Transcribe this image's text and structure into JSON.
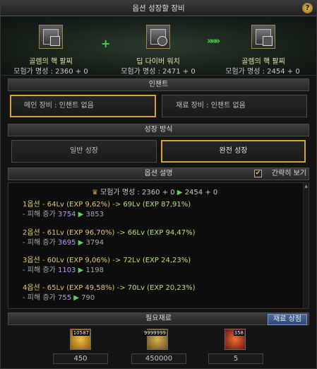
{
  "title": "옵션 성장할 장비",
  "help_label": "?",
  "items": {
    "left": {
      "name": "골렘의 핵 팔찌",
      "fame": "모험가 명성 : 2360 + 0"
    },
    "middle": {
      "name": "딥 다이버 워치",
      "fame": "모험가 명성 : 2471 + 0"
    },
    "right": {
      "name": "골렘의 핵 팔찌",
      "fame": "모험가 명성 : 2454 + 0"
    },
    "plus": "+",
    "arrows": "»»»"
  },
  "enchant": {
    "header": "인챈트",
    "main": "메인 장비 : 인챈트 없음",
    "material": "재료 장비 : 인챈트 없음"
  },
  "growth": {
    "header": "성장 방식",
    "normal": "일반 성장",
    "full": "완전 성장",
    "selected": "full"
  },
  "options": {
    "header": "옵션 설명",
    "simple_label": "간략히 보기",
    "simple_checked": true,
    "fame_prefix": "모험가 명성 : 2360 + 0",
    "fame_arrow": "▶",
    "fame_result": "2454 + 0",
    "lines": [
      {
        "title": "1옵션 - 64Lv (EXP 9,62%) -> ",
        "result": "69Lv (EXP 87,91%)",
        "dmg_label": "- 피해 증가",
        "dmg_from": "3754",
        "dmg_to": "3853"
      },
      {
        "title": "2옵션 - 61Lv (EXP 96,70%) -> ",
        "result": "66Lv (EXP 94,47%)",
        "dmg_label": "- 피해 증가",
        "dmg_from": "3695",
        "dmg_to": "3794"
      },
      {
        "title": "3옵션 - 60Lv (EXP 9,06%) -> ",
        "result": "72Lv (EXP 24,23%)",
        "dmg_label": "- 피해 증가",
        "dmg_from": "1103",
        "dmg_to": "1198"
      },
      {
        "title": "4옵션 - 65Lv (EXP 49,58%) -> ",
        "result": "70Lv (EXP 20,23%)",
        "dmg_label": "- 피해 증가",
        "dmg_from": "755",
        "dmg_to": "790"
      }
    ]
  },
  "materials": {
    "header": "필요재료",
    "shop_button": "재료 상점",
    "items": [
      {
        "icon": "gold-gem-icon",
        "count": "10587",
        "qty": "450",
        "color": "#d9a520"
      },
      {
        "icon": "gold-coins-icon",
        "count": "9999999",
        "qty": "450000",
        "color": "#b89030"
      },
      {
        "icon": "red-spark-icon",
        "count": "358",
        "qty": "5",
        "color": "#c23030"
      }
    ]
  }
}
